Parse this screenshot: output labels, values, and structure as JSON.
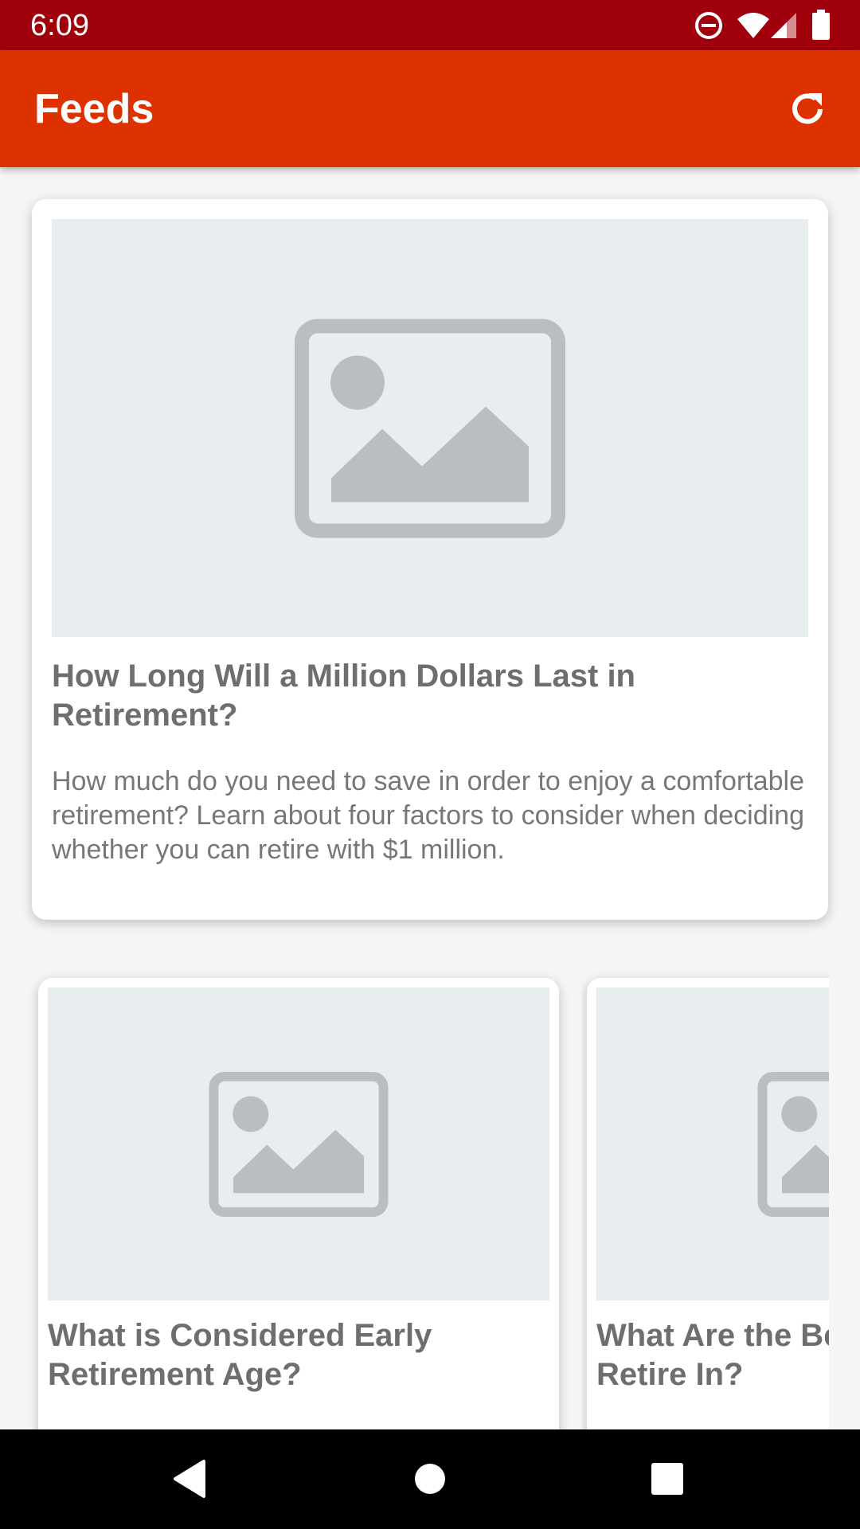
{
  "status_bar": {
    "time": "6:09",
    "icons": [
      "do-not-disturb-icon",
      "wifi-icon",
      "signal-icon",
      "battery-icon"
    ]
  },
  "app_bar": {
    "title": "Feeds",
    "refresh_icon": "refresh-icon"
  },
  "featured": {
    "title": "How Long Will a Million Dollars Last in Retirement?",
    "description": "How much do you need to save in order to enjoy a comfortable retirement? Learn about four factors to consider when deciding whether you can retire with $1 million."
  },
  "carousel": [
    {
      "title": "What is Considered Early Retirement Age?"
    },
    {
      "title": "What Are the Be  Retire In?"
    }
  ],
  "nav_bar": {
    "back_icon": "back-icon",
    "home_icon": "home-icon",
    "recents_icon": "recents-icon"
  },
  "colors": {
    "status_bar": "#a0000c",
    "app_bar": "#dd3100",
    "image_placeholder": "#e8edf0",
    "placeholder_icon": "#bbbec1"
  }
}
